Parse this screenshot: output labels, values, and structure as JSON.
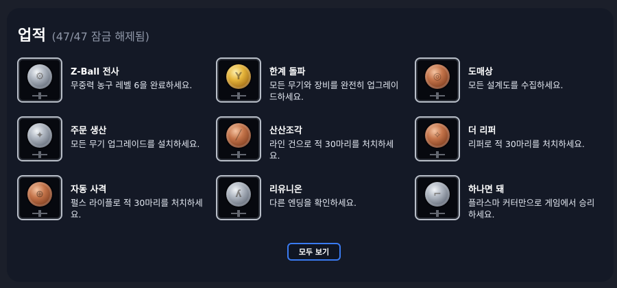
{
  "header": {
    "title": "업적",
    "subtitle": "(47/47 잠금 해제됨)"
  },
  "achievements": [
    {
      "name": "Z-Ball 전사",
      "desc": "무중력 농구 레벨 6을 완료하세요.",
      "medal": "silver"
    },
    {
      "name": "한계 돌파",
      "desc": "모든 무기와 장비를 완전히 업그레이드하세요.",
      "medal": "gold"
    },
    {
      "name": "도매상",
      "desc": "모든 설계도를 수집하세요.",
      "medal": "bronze"
    },
    {
      "name": "주문 생산",
      "desc": "모든 무기 업그레이드를 설치하세요.",
      "medal": "silver"
    },
    {
      "name": "산산조각",
      "desc": "라인 건으로 적 30마리를 처치하세요.",
      "medal": "bronze"
    },
    {
      "name": "더 리퍼",
      "desc": "리퍼로 적 30마리를 처치하세요.",
      "medal": "bronze"
    },
    {
      "name": "자동 사격",
      "desc": "펄스 라이플로 적 30마리를 처치하세요.",
      "medal": "bronze"
    },
    {
      "name": "리유니온",
      "desc": "다른 엔딩을 확인하세요.",
      "medal": "silver"
    },
    {
      "name": "하나면 돼",
      "desc": "플라스마 커터만으로 게임에서 승리하세요.",
      "medal": "silver"
    }
  ],
  "view_all_label": "모두 보기",
  "colors": {
    "panel": "#141926",
    "accent": "#3a7bf2",
    "silver": "#b5bcc6",
    "gold": "#e5b43a",
    "bronze": "#c4744a"
  },
  "icons": {
    "badge_icon": "medal-icon"
  }
}
